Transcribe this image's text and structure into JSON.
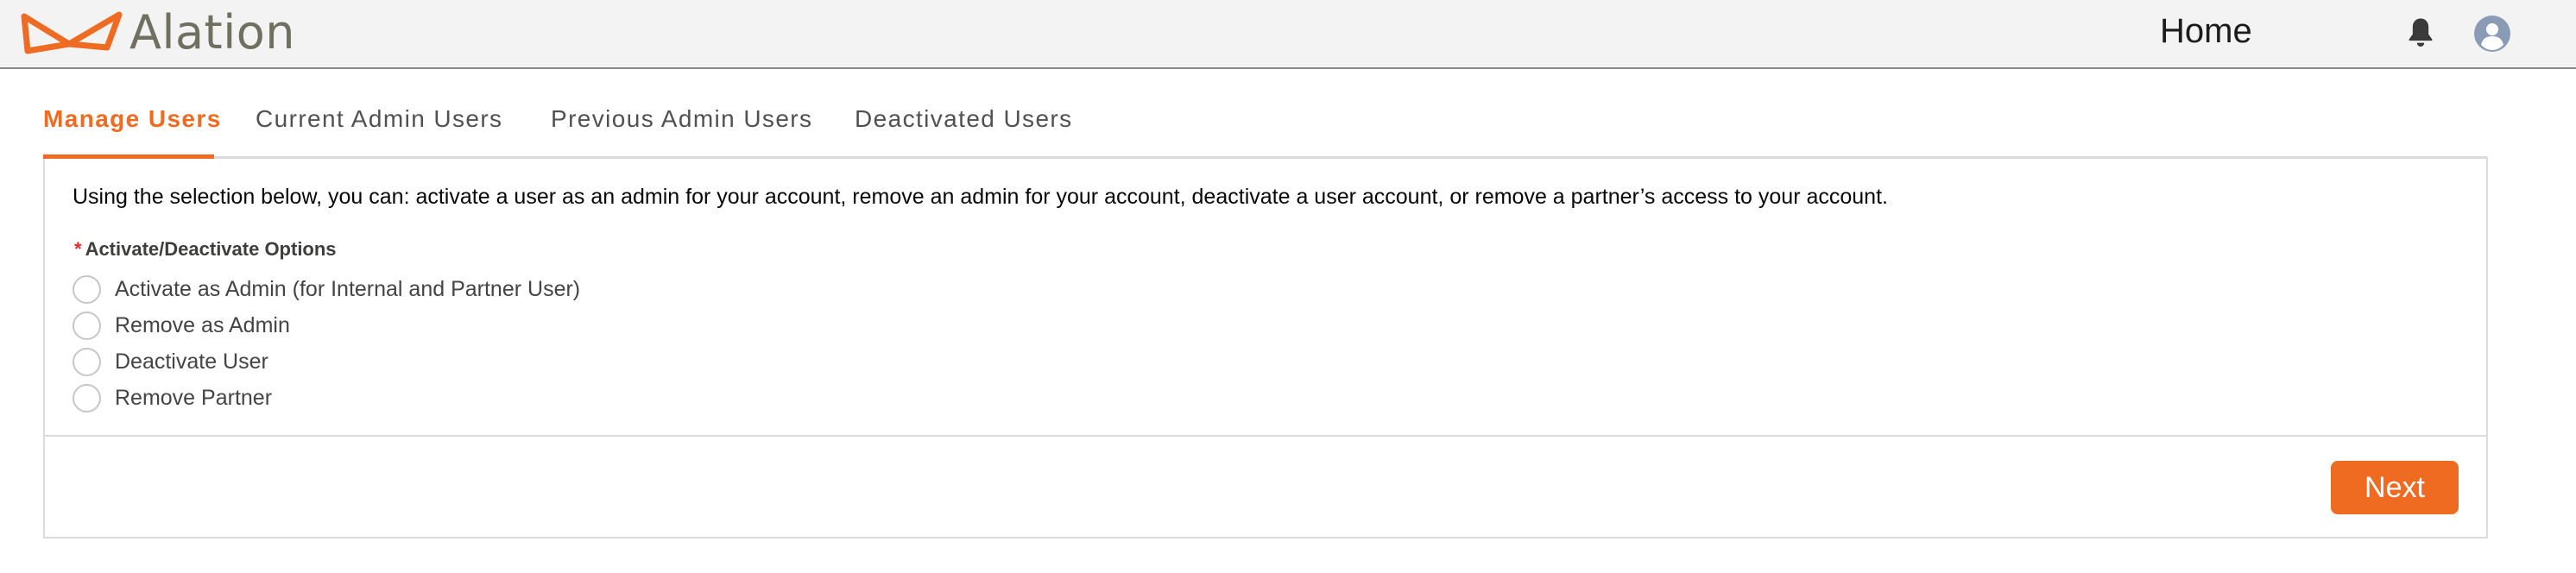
{
  "header": {
    "logo_text": "Alation",
    "nav_home": "Home",
    "brand_color": "#f06b22",
    "icons": [
      "alation-logo-icon",
      "bell-icon",
      "user-avatar-icon"
    ]
  },
  "tabs": [
    {
      "label": "Manage Users",
      "active": true
    },
    {
      "label": "Current Admin Users",
      "active": false
    },
    {
      "label": "Previous Admin Users",
      "active": false
    },
    {
      "label": "Deactivated Users",
      "active": false
    }
  ],
  "form": {
    "intro": "Using the selection below, you can: activate a user as an admin for your account, remove an admin for your account, deactivate a user account, or remove a partner’s access to your account.",
    "required_marker": "*",
    "field_label": "Activate/Deactivate Options",
    "options": [
      {
        "label": "Activate as Admin (for Internal and Partner User)",
        "selected": false
      },
      {
        "label": "Remove as Admin",
        "selected": false
      },
      {
        "label": "Deactivate User",
        "selected": false
      },
      {
        "label": "Remove Partner",
        "selected": false
      }
    ],
    "next_label": "Next"
  }
}
